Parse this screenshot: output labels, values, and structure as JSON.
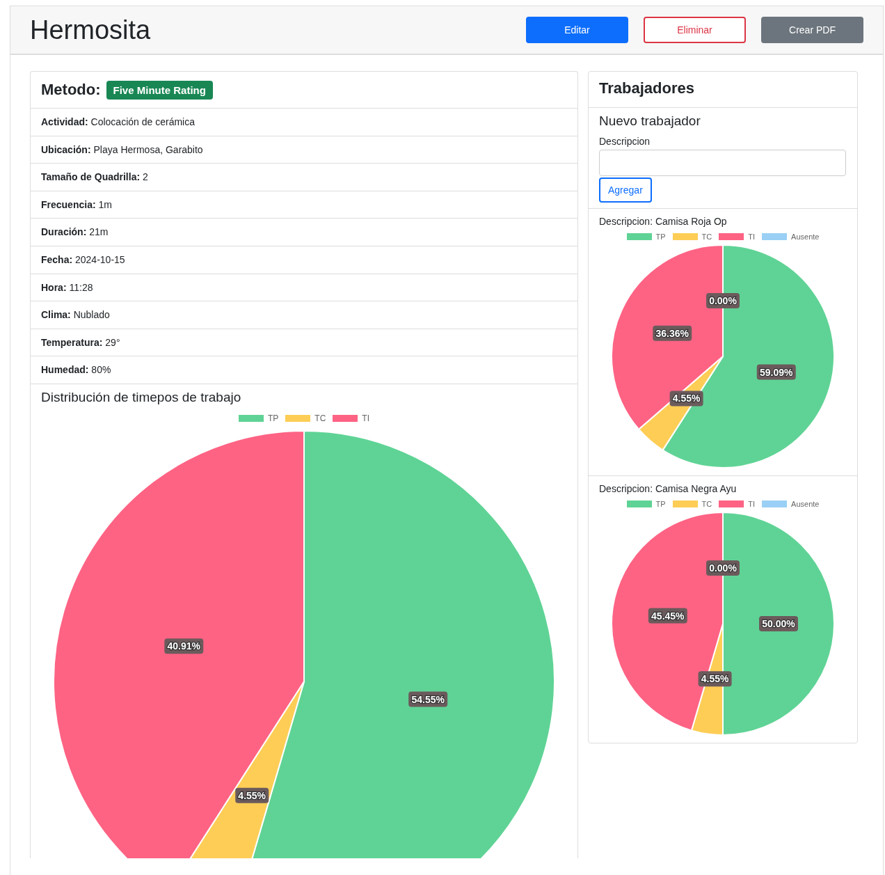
{
  "header": {
    "title": "Hermosita",
    "buttons": [
      {
        "label": "Editar",
        "kind": "primary"
      },
      {
        "label": "Eliminar",
        "kind": "outline-danger"
      },
      {
        "label": "Crear PDF",
        "kind": "secondary"
      }
    ]
  },
  "method": {
    "label": "Metodo:",
    "badge": "Five Minute Rating"
  },
  "details": [
    "**Actividad:** Colocación de cerámica",
    "**Ubicación:** Playa Hermosa, Garabito",
    "**Tamaño de Quadrilla:** 2",
    "**Frecuencia:** 1m",
    "**Duración:** 21m",
    "**Fecha:** 2024-10-15",
    "**Hora:** 11:28",
    "**Clima:** Nublado",
    "**Temperatura:** 29°",
    "**Humedad:** 80%"
  ],
  "distribution": {
    "title": "Distribución de timepos de trabajo",
    "chart_data": {
      "type": "pie",
      "categories": [
        "TP",
        "TC",
        "TI"
      ],
      "colors": [
        "#5fd395",
        "#fdcd56",
        "#fe6384"
      ],
      "values": [
        54.55,
        4.55,
        40.91
      ],
      "value_labels": [
        "54.55%",
        "4.55%",
        "40.91%"
      ]
    }
  },
  "workers": {
    "title": "Trabajadores",
    "form": {
      "title": "Nuevo trabajador",
      "field_label": "Descripcion",
      "button": "Agregar"
    },
    "items": [
      {
        "description": "Descripcion: Camisa Roja Op",
        "chart_data": {
          "type": "pie",
          "categories": [
            "TP",
            "TC",
            "TI",
            "Ausente"
          ],
          "colors": [
            "#5fd395",
            "#fdcd56",
            "#fe6384",
            "#9ad0f5"
          ],
          "values": [
            59.09,
            4.55,
            36.36,
            0
          ],
          "value_labels": [
            "59.09%",
            "4.55%",
            "36.36%",
            "0.00%"
          ]
        }
      },
      {
        "description": "Descripcion: Camisa Negra Ayu",
        "chart_data": {
          "type": "pie",
          "categories": [
            "TP",
            "TC",
            "TI",
            "Ausente"
          ],
          "colors": [
            "#5fd395",
            "#fdcd56",
            "#fe6384",
            "#9ad0f5"
          ],
          "values": [
            50.0,
            4.55,
            45.45,
            0
          ],
          "value_labels": [
            "50.00%",
            "4.55%",
            "45.45%",
            "0.00%"
          ]
        }
      }
    ]
  }
}
